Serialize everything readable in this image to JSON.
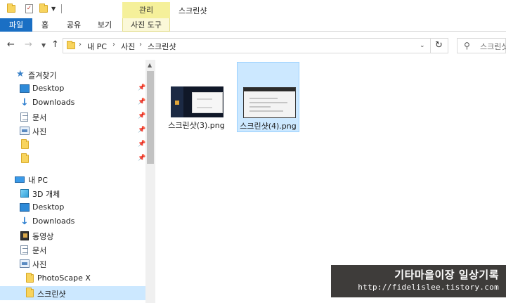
{
  "titlebar": {
    "context_tab_group": "관리",
    "window_title": "스크린샷"
  },
  "ribbon": {
    "tabs": [
      {
        "label": "파일"
      },
      {
        "label": "홈"
      },
      {
        "label": "공유"
      },
      {
        "label": "보기"
      },
      {
        "label": "사진 도구"
      }
    ]
  },
  "address_bar": {
    "breadcrumbs": [
      "내 PC",
      "사진",
      "스크린샷"
    ],
    "separator": "›"
  },
  "search": {
    "placeholder": "스크린샷"
  },
  "nav_pane": {
    "quick_access": {
      "label": "즐겨찾기",
      "items": [
        {
          "label": "Desktop",
          "icon": "desktop-icon"
        },
        {
          "label": "Downloads",
          "icon": "download-arrow-icon"
        },
        {
          "label": "문서",
          "icon": "document-icon"
        },
        {
          "label": "사진",
          "icon": "pictures-icon"
        },
        {
          "label": "",
          "icon": "folder-icon"
        },
        {
          "label": "",
          "icon": "folder-icon"
        }
      ]
    },
    "this_pc": {
      "label": "내 PC",
      "items": [
        {
          "label": "3D 개체",
          "icon": "3d-objects-icon"
        },
        {
          "label": "Desktop",
          "icon": "desktop-icon"
        },
        {
          "label": "Downloads",
          "icon": "download-arrow-icon"
        },
        {
          "label": "동영상",
          "icon": "video-icon"
        },
        {
          "label": "문서",
          "icon": "document-icon"
        },
        {
          "label": "사진",
          "icon": "pictures-icon"
        },
        {
          "label": "PhotoScape X",
          "icon": "folder-icon"
        },
        {
          "label": "스크린샷",
          "icon": "folder-icon",
          "selected": true
        }
      ]
    }
  },
  "files": [
    {
      "name": "스크린샷(3).png",
      "selected": false
    },
    {
      "name": "스크린샷(4).png",
      "selected": true
    }
  ],
  "watermark": {
    "title": "기타마을이장 일상기록",
    "url": "http://fidelislee.tistory.com"
  },
  "colors": {
    "file_tab": "#1a6fc4",
    "context_tab": "#f5f09a",
    "selection": "#cce8ff",
    "folder": "#f8d45e"
  }
}
